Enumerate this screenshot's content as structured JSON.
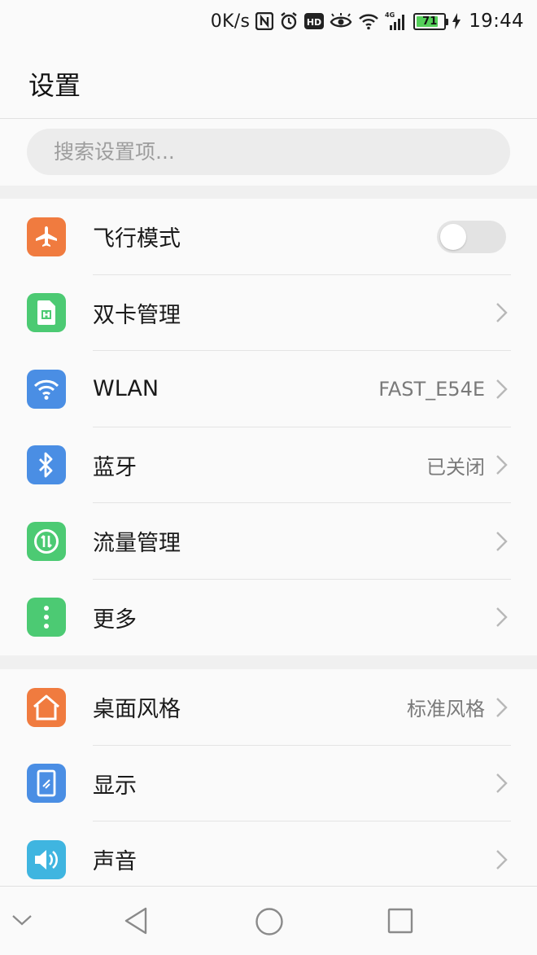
{
  "status_bar": {
    "net_speed": "0K/s",
    "network_type": "4G",
    "battery_level": "71",
    "time": "19:44",
    "icons": [
      "nfc-icon",
      "alarm-icon",
      "hd-icon",
      "eye-comfort-icon",
      "wifi-icon",
      "cell-signal-icon",
      "battery-icon",
      "charging-icon"
    ]
  },
  "header": {
    "title": "设置"
  },
  "search": {
    "placeholder": "搜索设置项..."
  },
  "groups": [
    {
      "items": [
        {
          "id": "airplane",
          "label": "飞行模式",
          "icon": "airplane-icon",
          "color": "#f07b3f",
          "toggle": "off"
        },
        {
          "id": "dual-sim",
          "label": "双卡管理",
          "icon": "sim-card-icon",
          "color": "#4cca73"
        },
        {
          "id": "wlan",
          "label": "WLAN",
          "value": "FAST_E54E",
          "icon": "wifi-icon",
          "color": "#4a8ee4"
        },
        {
          "id": "bluetooth",
          "label": "蓝牙",
          "value": "已关闭",
          "icon": "bluetooth-icon",
          "color": "#4a8ee4"
        },
        {
          "id": "data-usage",
          "label": "流量管理",
          "icon": "data-usage-icon",
          "color": "#4cca73"
        },
        {
          "id": "more",
          "label": "更多",
          "icon": "more-dots-icon",
          "color": "#4cca73"
        }
      ]
    },
    {
      "items": [
        {
          "id": "home-style",
          "label": "桌面风格",
          "value": "标准风格",
          "icon": "home-icon",
          "color": "#f07b3f"
        },
        {
          "id": "display",
          "label": "显示",
          "icon": "display-icon",
          "color": "#4a8ee4"
        },
        {
          "id": "sound",
          "label": "声音",
          "icon": "sound-icon",
          "color": "#3fb5e0"
        }
      ]
    }
  ],
  "nav_bar": {
    "buttons": [
      "collapse-icon",
      "back-icon",
      "home-circle-icon",
      "recents-icon"
    ]
  }
}
